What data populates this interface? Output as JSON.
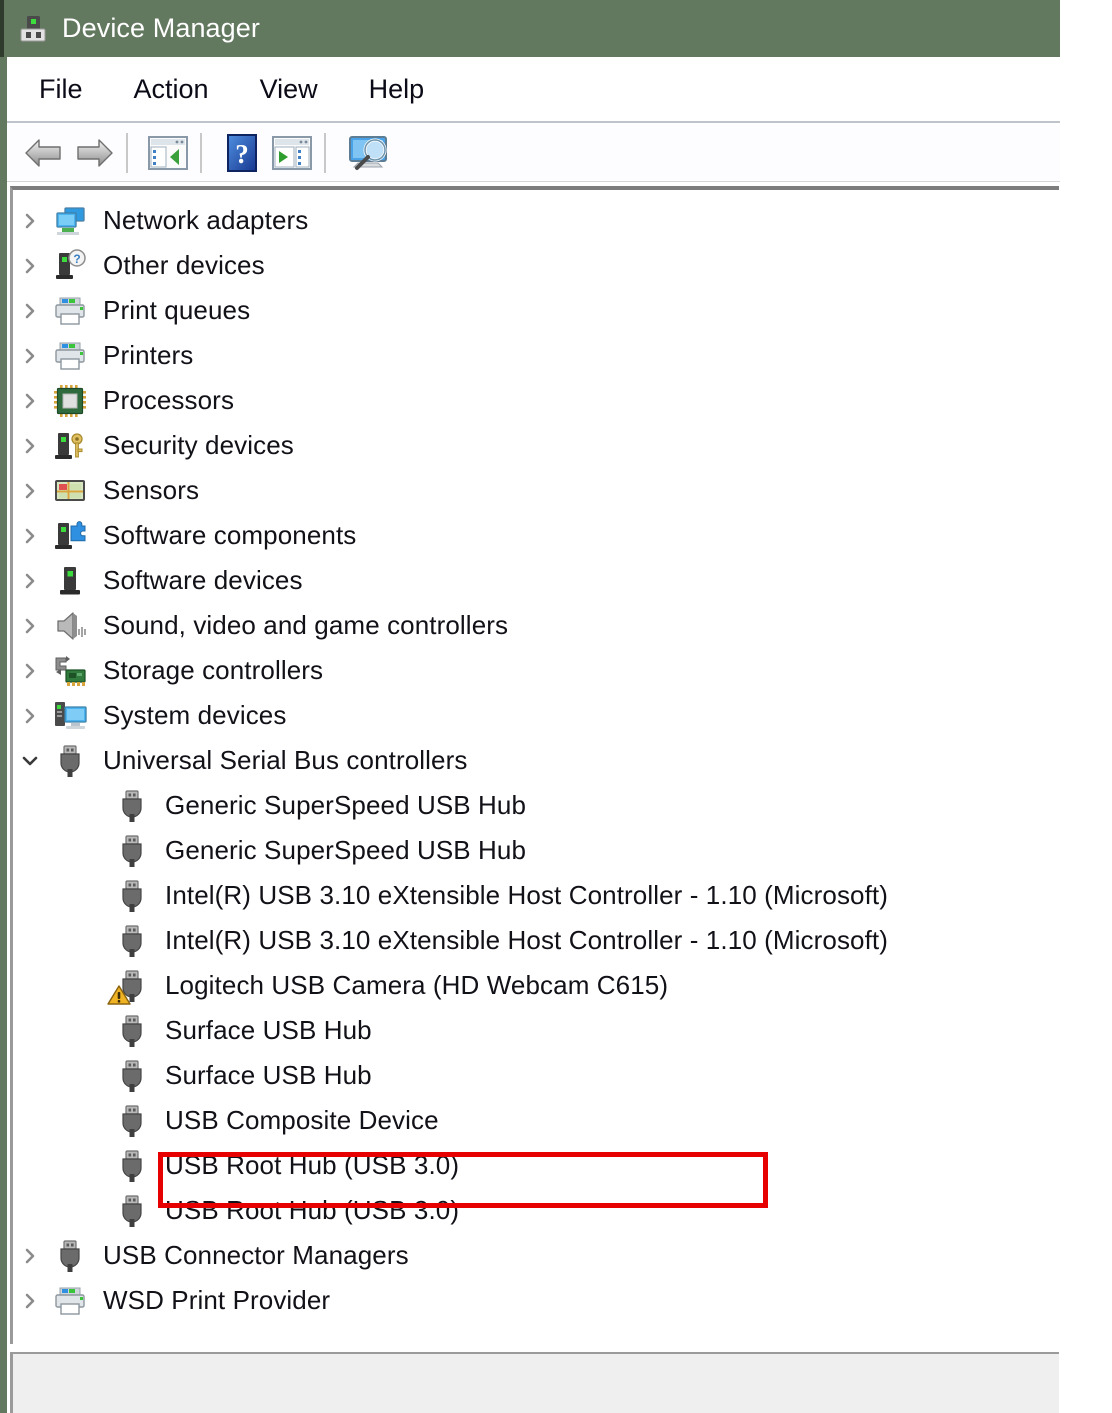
{
  "window": {
    "title": "Device Manager",
    "title_icon": "device-manager-icon",
    "accent_color": "#63795f",
    "highlight_color": "#e60000"
  },
  "menubar": {
    "items": [
      {
        "label": "File",
        "name": "menu-file"
      },
      {
        "label": "Action",
        "name": "menu-action"
      },
      {
        "label": "View",
        "name": "menu-view"
      },
      {
        "label": "Help",
        "name": "menu-help"
      }
    ]
  },
  "toolbar": {
    "buttons": [
      {
        "icon": "back-arrow-icon",
        "tooltip": "Back"
      },
      {
        "icon": "forward-arrow-icon",
        "tooltip": "Forward"
      },
      {
        "icon": "show-console-tree-icon",
        "tooltip": "Show/Hide console tree"
      },
      {
        "icon": "help-question-icon",
        "tooltip": "Help"
      },
      {
        "icon": "properties-icon",
        "tooltip": "Properties"
      },
      {
        "icon": "scan-hardware-changes-icon",
        "tooltip": "Scan for hardware changes"
      }
    ]
  },
  "tree": {
    "rows": [
      {
        "label": "Network adapters",
        "icon": "network-adapter-icon",
        "depth": 0,
        "state": "collapsed"
      },
      {
        "label": "Other devices",
        "icon": "unknown-device-icon",
        "depth": 0,
        "state": "collapsed"
      },
      {
        "label": "Print queues",
        "icon": "printer-icon",
        "depth": 0,
        "state": "collapsed"
      },
      {
        "label": "Printers",
        "icon": "printer-icon",
        "depth": 0,
        "state": "collapsed"
      },
      {
        "label": "Processors",
        "icon": "processor-chip-icon",
        "depth": 0,
        "state": "collapsed"
      },
      {
        "label": "Security devices",
        "icon": "security-key-icon",
        "depth": 0,
        "state": "collapsed"
      },
      {
        "label": "Sensors",
        "icon": "sensor-icon",
        "depth": 0,
        "state": "collapsed"
      },
      {
        "label": "Software components",
        "icon": "software-component-icon",
        "depth": 0,
        "state": "collapsed"
      },
      {
        "label": "Software devices",
        "icon": "software-device-icon",
        "depth": 0,
        "state": "collapsed"
      },
      {
        "label": "Sound, video and game controllers",
        "icon": "speaker-icon",
        "depth": 0,
        "state": "collapsed"
      },
      {
        "label": "Storage controllers",
        "icon": "storage-controller-icon",
        "depth": 0,
        "state": "collapsed"
      },
      {
        "label": "System devices",
        "icon": "system-device-icon",
        "depth": 0,
        "state": "collapsed"
      },
      {
        "label": "Universal Serial Bus controllers",
        "icon": "usb-icon",
        "depth": 0,
        "state": "expanded"
      },
      {
        "label": "Generic SuperSpeed USB Hub",
        "icon": "usb-icon",
        "depth": 1,
        "state": "leaf"
      },
      {
        "label": "Generic SuperSpeed USB Hub",
        "icon": "usb-icon",
        "depth": 1,
        "state": "leaf"
      },
      {
        "label": "Intel(R) USB 3.10 eXtensible Host Controller - 1.10 (Microsoft)",
        "icon": "usb-icon",
        "depth": 1,
        "state": "leaf"
      },
      {
        "label": "Intel(R) USB 3.10 eXtensible Host Controller - 1.10 (Microsoft)",
        "icon": "usb-icon",
        "depth": 1,
        "state": "leaf"
      },
      {
        "label": "Logitech USB Camera (HD Webcam C615)",
        "icon": "usb-warning-icon",
        "depth": 1,
        "state": "leaf",
        "warning": true,
        "highlighted": true
      },
      {
        "label": "Surface USB Hub",
        "icon": "usb-icon",
        "depth": 1,
        "state": "leaf"
      },
      {
        "label": "Surface USB Hub",
        "icon": "usb-icon",
        "depth": 1,
        "state": "leaf"
      },
      {
        "label": "USB Composite Device",
        "icon": "usb-icon",
        "depth": 1,
        "state": "leaf"
      },
      {
        "label": "USB Root Hub (USB 3.0)",
        "icon": "usb-icon",
        "depth": 1,
        "state": "leaf"
      },
      {
        "label": "USB Root Hub (USB 3.0)",
        "icon": "usb-icon",
        "depth": 1,
        "state": "leaf"
      },
      {
        "label": "USB Connector Managers",
        "icon": "usb-icon",
        "depth": 0,
        "state": "collapsed"
      },
      {
        "label": "WSD Print Provider",
        "icon": "printer-icon",
        "depth": 0,
        "state": "collapsed"
      }
    ]
  },
  "statusbar": {
    "text": ""
  }
}
